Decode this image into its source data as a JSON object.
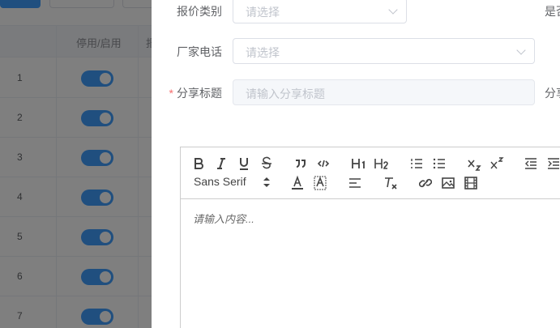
{
  "table": {
    "columns": {
      "toggle_label": "停用/启用",
      "partial_label": "报"
    },
    "rows": [
      {
        "index": "1",
        "enabled": true
      },
      {
        "index": "2",
        "enabled": true
      },
      {
        "index": "3",
        "enabled": true
      },
      {
        "index": "4",
        "enabled": true
      },
      {
        "index": "5",
        "enabled": true
      },
      {
        "index": "6",
        "enabled": true
      },
      {
        "index": "7",
        "enabled": true
      }
    ]
  },
  "form": {
    "quote_type": {
      "label": "报价类别",
      "placeholder": "请选择"
    },
    "factory_phone": {
      "label": "厂家电话",
      "placeholder": "请选择"
    },
    "share_title": {
      "label": "分享标题",
      "placeholder": "请输入分享标题",
      "required_mark": "*"
    },
    "right_partial_1": "是否",
    "right_partial_2": "分享"
  },
  "editor": {
    "font_name": "Sans Serif",
    "placeholder": "请输入内容...",
    "icons": [
      "bold-icon",
      "italic-icon",
      "underline-icon",
      "strike-icon",
      "blockquote-icon",
      "code-block-icon",
      "header-1-icon",
      "header-2-icon",
      "ordered-list-icon",
      "bullet-list-icon",
      "subscript-icon",
      "superscript-icon",
      "outdent-icon",
      "indent-icon",
      "font-color-icon",
      "background-color-icon",
      "align-icon",
      "clean-format-icon",
      "link-icon",
      "image-icon",
      "video-icon"
    ]
  },
  "colors": {
    "accent": "#409eff",
    "required": "#f56c6c",
    "overlay": "rgba(0,0,0,0.5)"
  }
}
